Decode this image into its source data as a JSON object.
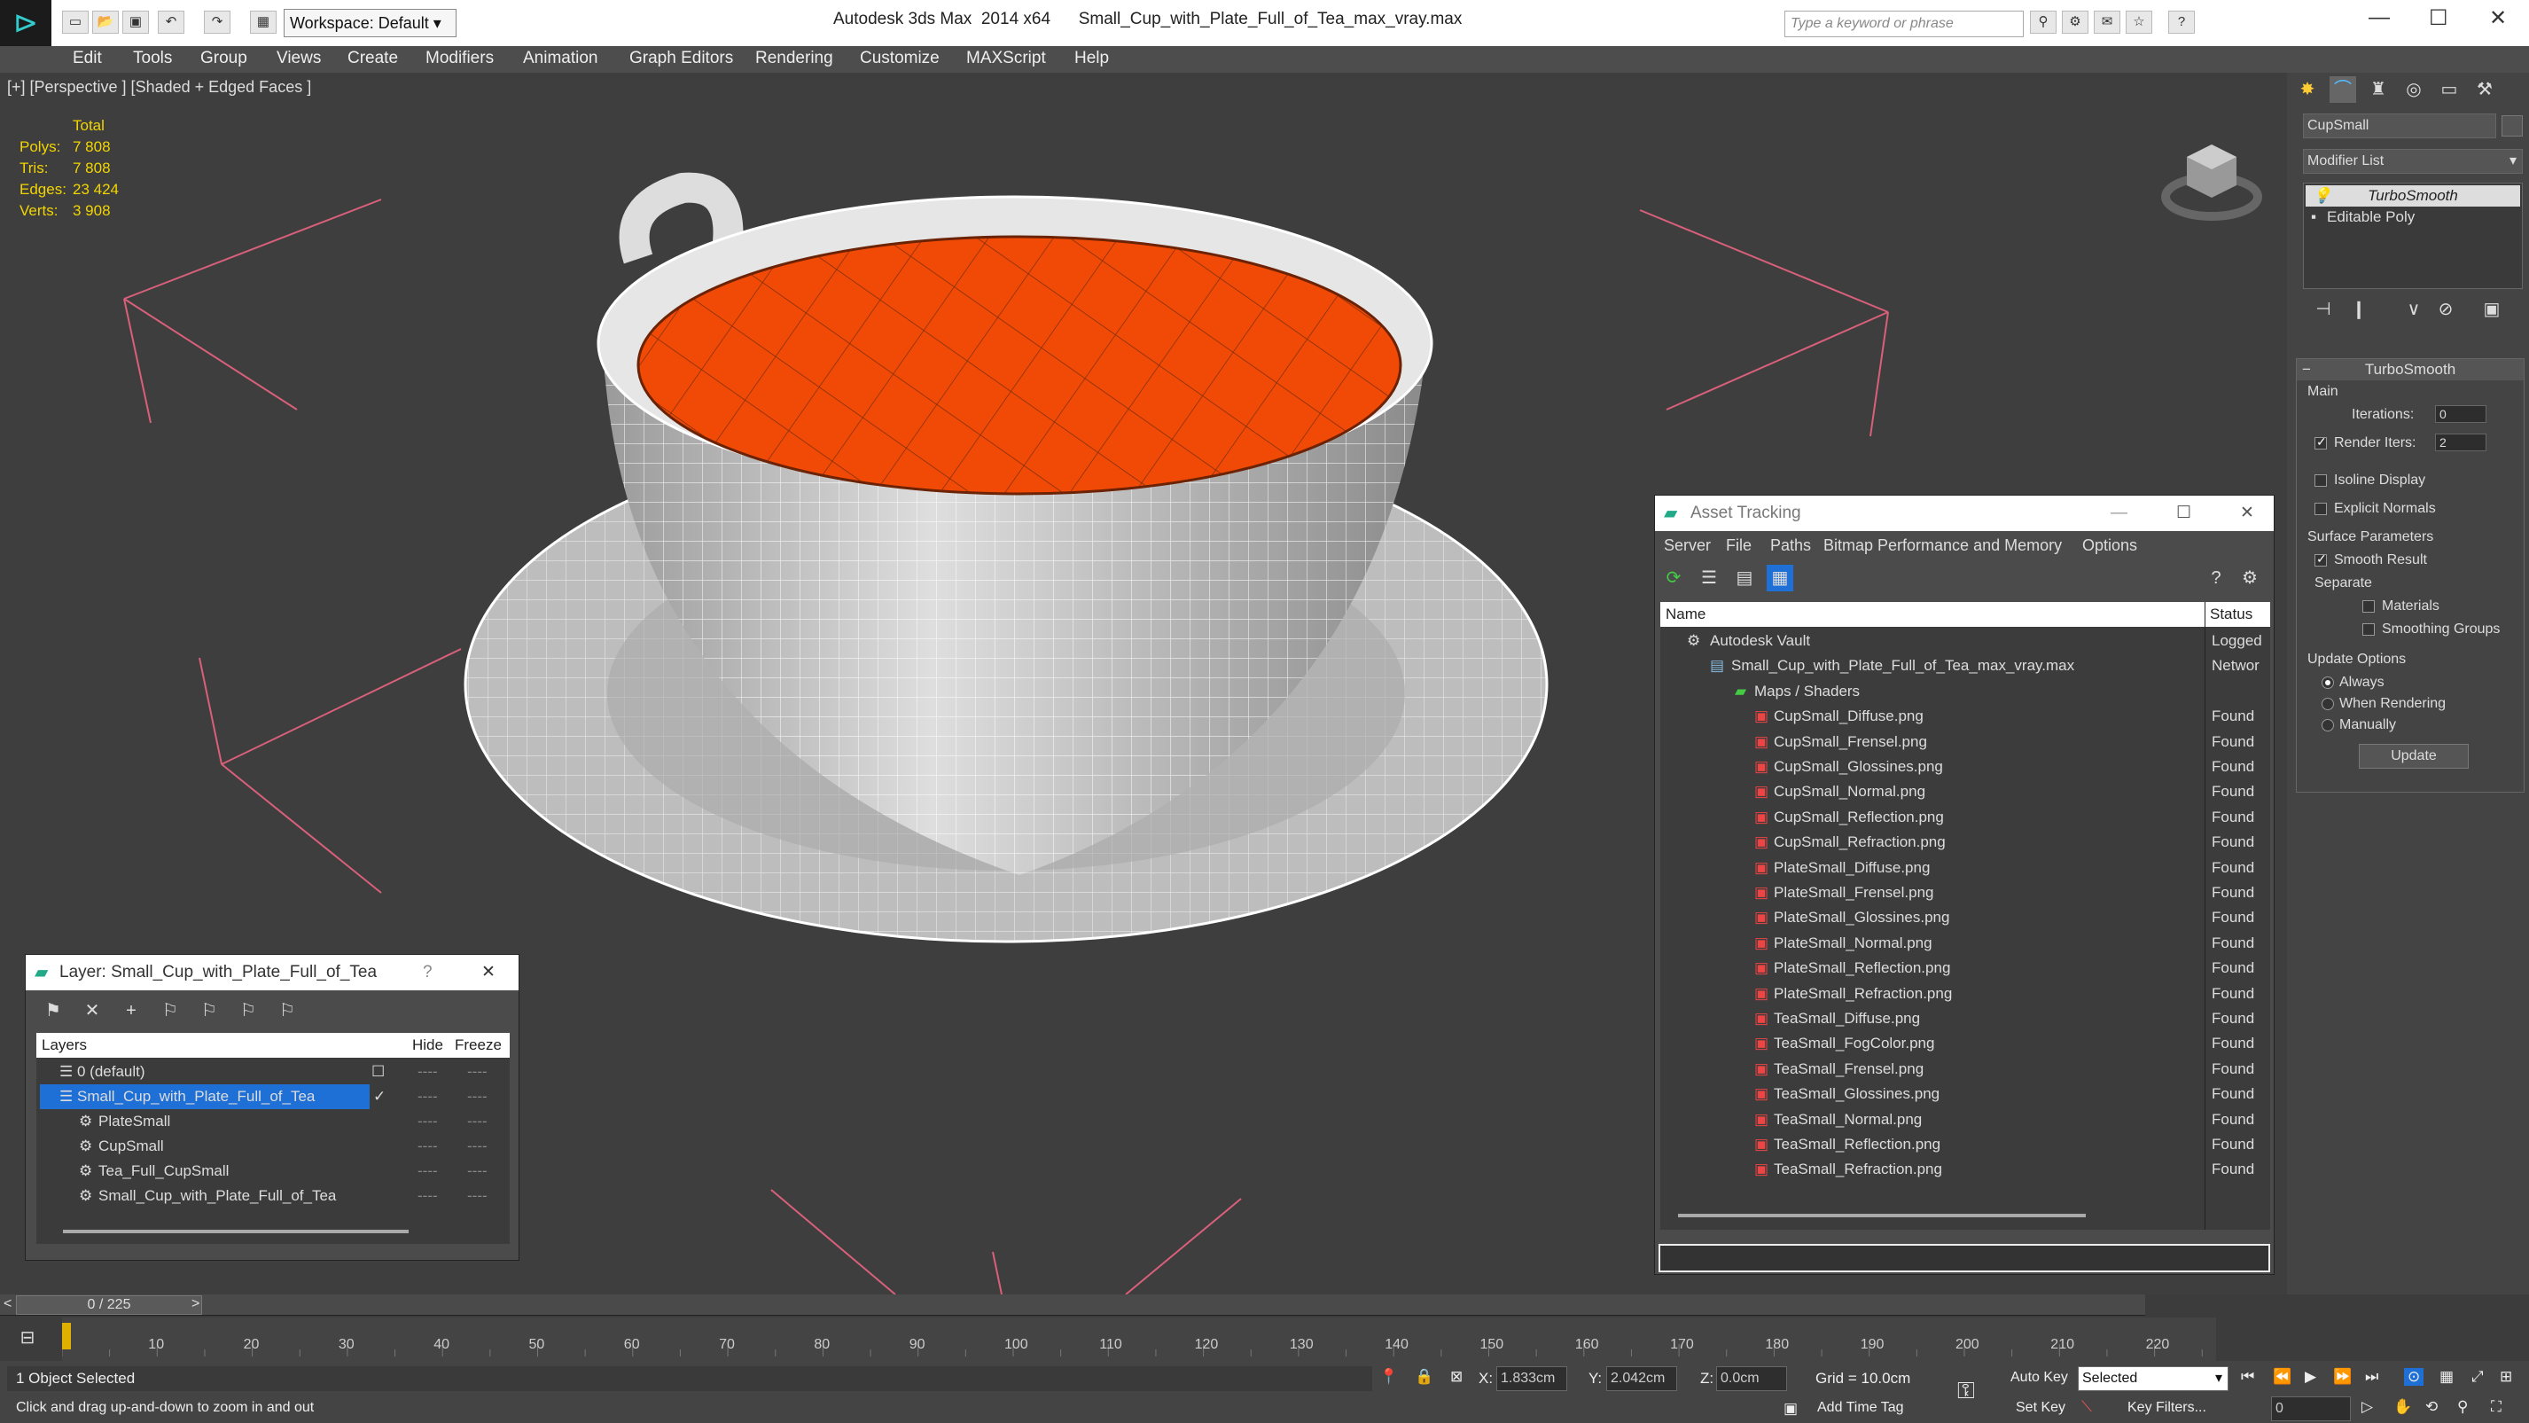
{
  "app": {
    "title": "Autodesk 3ds Max  2014 x64      Small_Cup_with_Plate_Full_of_Tea_max_vray.max",
    "workspace": "Workspace: Default",
    "search_placeholder": "Type a keyword or phrase"
  },
  "menu": [
    "Edit",
    "Tools",
    "Group",
    "Views",
    "Create",
    "Modifiers",
    "Animation",
    "Graph Editors",
    "Rendering",
    "Customize",
    "MAXScript",
    "Help"
  ],
  "viewport": {
    "label": "[+] [Perspective ] [Shaded + Edged Faces ]",
    "stats": {
      "header": "Total",
      "polys_label": "Polys:",
      "polys": "7 808",
      "tris_label": "Tris:",
      "tris": "7 808",
      "edges_label": "Edges:",
      "edges": "23 424",
      "verts_label": "Verts:",
      "verts": "3 908"
    }
  },
  "layer_panel": {
    "title": "Layer: Small_Cup_with_Plate_Full_of_Tea",
    "help": "?",
    "close": "✕",
    "col_layers": "Layers",
    "col_hide": "Hide",
    "col_freeze": "Freeze",
    "rows": [
      {
        "name": "0 (default)",
        "hide": "----",
        "freeze": "----"
      },
      {
        "name": "Small_Cup_with_Plate_Full_of_Tea",
        "hide": "----",
        "freeze": "----"
      },
      {
        "name": "PlateSmall",
        "hide": "----",
        "freeze": "----"
      },
      {
        "name": "CupSmall",
        "hide": "----",
        "freeze": "----"
      },
      {
        "name": "Tea_Full_CupSmall",
        "hide": "----",
        "freeze": "----"
      },
      {
        "name": "Small_Cup_with_Plate_Full_of_Tea",
        "hide": "----",
        "freeze": "----"
      }
    ]
  },
  "asset_panel": {
    "title": "Asset Tracking",
    "menu": [
      "Server",
      "File",
      "Paths",
      "Bitmap Performance and Memory",
      "Options"
    ],
    "col_name": "Name",
    "col_status": "Status",
    "rows": [
      {
        "name": "Autodesk Vault",
        "status": "Logged"
      },
      {
        "name": "Small_Cup_with_Plate_Full_of_Tea_max_vray.max",
        "status": "Networ"
      },
      {
        "name": "Maps / Shaders",
        "status": ""
      },
      {
        "name": "CupSmall_Diffuse.png",
        "status": "Found"
      },
      {
        "name": "CupSmall_Frensel.png",
        "status": "Found"
      },
      {
        "name": "CupSmall_Glossines.png",
        "status": "Found"
      },
      {
        "name": "CupSmall_Normal.png",
        "status": "Found"
      },
      {
        "name": "CupSmall_Reflection.png",
        "status": "Found"
      },
      {
        "name": "CupSmall_Refraction.png",
        "status": "Found"
      },
      {
        "name": "PlateSmall_Diffuse.png",
        "status": "Found"
      },
      {
        "name": "PlateSmall_Frensel.png",
        "status": "Found"
      },
      {
        "name": "PlateSmall_Glossines.png",
        "status": "Found"
      },
      {
        "name": "PlateSmall_Normal.png",
        "status": "Found"
      },
      {
        "name": "PlateSmall_Reflection.png",
        "status": "Found"
      },
      {
        "name": "PlateSmall_Refraction.png",
        "status": "Found"
      },
      {
        "name": "TeaSmall_Diffuse.png",
        "status": "Found"
      },
      {
        "name": "TeaSmall_FogColor.png",
        "status": "Found"
      },
      {
        "name": "TeaSmall_Frensel.png",
        "status": "Found"
      },
      {
        "name": "TeaSmall_Glossines.png",
        "status": "Found"
      },
      {
        "name": "TeaSmall_Normal.png",
        "status": "Found"
      },
      {
        "name": "TeaSmall_Reflection.png",
        "status": "Found"
      },
      {
        "name": "TeaSmall_Refraction.png",
        "status": "Found"
      }
    ]
  },
  "command_panel": {
    "object_name": "CupSmall",
    "modifier_list": "Modifier List",
    "stack": [
      "TurboSmooth",
      "Editable Poly"
    ],
    "rollout_title": "TurboSmooth",
    "main_label": "Main",
    "iterations_label": "Iterations:",
    "iterations": "0",
    "render_iters_label": "Render Iters:",
    "render_iters": "2",
    "isoline": "Isoline Display",
    "explicit_normals": "Explicit Normals",
    "surface_params": "Surface Parameters",
    "smooth_result": "Smooth Result",
    "separate": "Separate",
    "materials": "Materials",
    "smoothing_groups": "Smoothing Groups",
    "update_options": "Update Options",
    "always": "Always",
    "when_rendering": "When Rendering",
    "manually": "Manually",
    "update_button": "Update"
  },
  "timeline": {
    "frame": "0 / 225",
    "ticks": [
      "10",
      "20",
      "30",
      "40",
      "50",
      "60",
      "70",
      "80",
      "90",
      "100",
      "110",
      "120",
      "130",
      "140",
      "150",
      "160",
      "170",
      "180",
      "190",
      "200",
      "210",
      "220"
    ]
  },
  "status": {
    "selected": "1 Object Selected",
    "prompt": "Click and drag up-and-down to zoom in and out",
    "x_label": "X:",
    "x": "1.833cm",
    "y_label": "Y:",
    "y": "2.042cm",
    "z_label": "Z:",
    "z": "0.0cm",
    "grid": "Grid = 10.0cm",
    "add_time_tag": "Add Time Tag",
    "auto_key": "Auto Key",
    "selected_mode": "Selected",
    "set_key": "Set Key",
    "key_filters": "Key Filters...",
    "frame_field": "0"
  },
  "colors": {
    "tea": "#f04a06",
    "wire": "#ffffff",
    "selection": "#1e6fd6",
    "stats": "#f2d500",
    "viewport_bg": "#3e3e3e"
  }
}
